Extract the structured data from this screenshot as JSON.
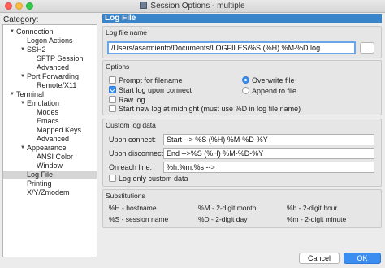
{
  "window": {
    "title": "Session Options - multiple"
  },
  "sidebar": {
    "label": "Category:",
    "items": [
      {
        "label": "Connection",
        "level": 0,
        "toggle": "▼"
      },
      {
        "label": "Logon Actions",
        "level": 1
      },
      {
        "label": "SSH2",
        "level": 1,
        "toggle": "▼"
      },
      {
        "label": "SFTP Session",
        "level": 2
      },
      {
        "label": "Advanced",
        "level": 2
      },
      {
        "label": "Port Forwarding",
        "level": 1,
        "toggle": "▼"
      },
      {
        "label": "Remote/X11",
        "level": 2
      },
      {
        "label": "Terminal",
        "level": 0,
        "toggle": "▼"
      },
      {
        "label": "Emulation",
        "level": 1,
        "toggle": "▼"
      },
      {
        "label": "Modes",
        "level": 2
      },
      {
        "label": "Emacs",
        "level": 2
      },
      {
        "label": "Mapped Keys",
        "level": 2
      },
      {
        "label": "Advanced",
        "level": 2
      },
      {
        "label": "Appearance",
        "level": 1,
        "toggle": "▼"
      },
      {
        "label": "ANSI Color",
        "level": 2
      },
      {
        "label": "Window",
        "level": 2
      },
      {
        "label": "Log File",
        "level": 1,
        "selected": true
      },
      {
        "label": "Printing",
        "level": 1
      },
      {
        "label": "X/Y/Zmodem",
        "level": 1
      }
    ]
  },
  "panel": {
    "header": "Log File",
    "log_file_name": {
      "label": "Log file name",
      "value": "/Users/asarmiento/Documents/LOGFILES/%S  (%H) %M-%D.log",
      "browse_label": "..."
    },
    "options": {
      "label": "Options",
      "prompt_for_filename": "Prompt for filename",
      "start_log_upon_connect": "Start log upon connect",
      "raw_log": "Raw log",
      "start_new_log_midnight": "Start new log at midnight (must use %D in log file name)",
      "overwrite_file": "Overwrite file",
      "append_to_file": "Append to file"
    },
    "custom_log_data": {
      "label": "Custom log data",
      "upon_connect_label": "Upon connect:",
      "upon_connect_value": "Start --> %S  (%H) %M-%D-%Y",
      "upon_disconnect_label": "Upon disconnect:",
      "upon_disconnect_value": "End -->%S  (%H) %M-%D-%Y",
      "on_each_line_label": "On each line:",
      "on_each_line_value": "%h:%m:%s --> |",
      "log_only_custom": "Log only custom data"
    },
    "substitutions": {
      "label": "Substitutions",
      "items": [
        "%H - hostname",
        "%M - 2-digit month",
        "%h - 2-digit hour",
        "%S - session name",
        "%D - 2-digit day",
        "%m - 2-digit minute"
      ]
    }
  },
  "footer": {
    "cancel_label": "Cancel",
    "ok_label": "OK"
  }
}
